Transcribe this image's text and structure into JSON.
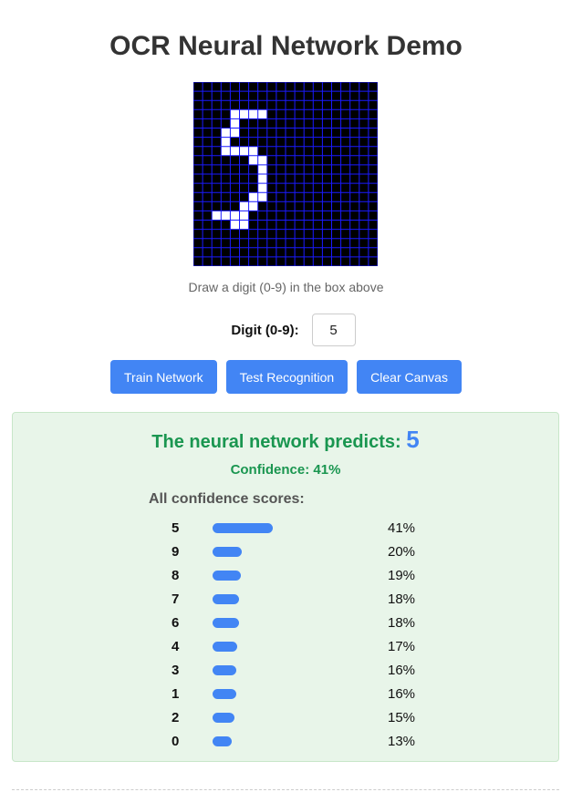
{
  "page": {
    "title": "OCR Neural Network Demo"
  },
  "canvas": {
    "instructions": "Draw a digit (0-9) in the box above",
    "grid_size": 20,
    "background_color": "#000000",
    "grid_color": "#1a1aff",
    "ink_color": "#ffffff",
    "drawn_cells": [
      [
        4,
        3
      ],
      [
        5,
        3
      ],
      [
        6,
        3
      ],
      [
        7,
        3
      ],
      [
        4,
        4
      ],
      [
        3,
        5
      ],
      [
        4,
        5
      ],
      [
        3,
        6
      ],
      [
        3,
        7
      ],
      [
        4,
        7
      ],
      [
        5,
        7
      ],
      [
        6,
        7
      ],
      [
        6,
        8
      ],
      [
        7,
        8
      ],
      [
        7,
        9
      ],
      [
        7,
        10
      ],
      [
        7,
        11
      ],
      [
        6,
        12
      ],
      [
        7,
        12
      ],
      [
        5,
        13
      ],
      [
        6,
        13
      ],
      [
        2,
        14
      ],
      [
        3,
        14
      ],
      [
        4,
        14
      ],
      [
        5,
        14
      ],
      [
        4,
        15
      ],
      [
        5,
        15
      ]
    ]
  },
  "digit_input": {
    "label": "Digit (0-9):",
    "value": "5"
  },
  "buttons": {
    "train": "Train Network",
    "test": "Test Recognition",
    "clear": "Clear Canvas"
  },
  "result": {
    "prediction_text": "The neural network predicts:",
    "prediction_value": "5",
    "confidence_text": "Confidence: 41%",
    "scores_heading": "All confidence scores:",
    "scores": [
      {
        "digit": "5",
        "percent": "41%",
        "value": 41
      },
      {
        "digit": "9",
        "percent": "20%",
        "value": 20
      },
      {
        "digit": "8",
        "percent": "19%",
        "value": 19
      },
      {
        "digit": "7",
        "percent": "18%",
        "value": 18
      },
      {
        "digit": "6",
        "percent": "18%",
        "value": 18
      },
      {
        "digit": "4",
        "percent": "17%",
        "value": 17
      },
      {
        "digit": "3",
        "percent": "16%",
        "value": 16
      },
      {
        "digit": "1",
        "percent": "16%",
        "value": 16
      },
      {
        "digit": "2",
        "percent": "15%",
        "value": 15
      },
      {
        "digit": "0",
        "percent": "13%",
        "value": 13
      }
    ]
  },
  "colors": {
    "accent": "#4285f4",
    "success": "#1a9650",
    "panel_background": "#e8f5e9"
  }
}
